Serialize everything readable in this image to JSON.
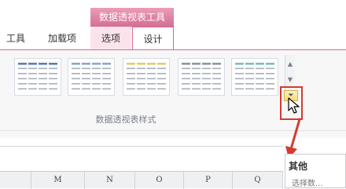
{
  "ribbon": {
    "context_tab_group": "数据透视表工具",
    "tabs": [
      {
        "label": "工具"
      },
      {
        "label": "加载项"
      },
      {
        "label": "选项"
      },
      {
        "label": "设计"
      }
    ],
    "active_tab": "设计",
    "gallery": {
      "group_label": "数据透视表样式",
      "styles": [
        {
          "name": "style-1",
          "accent": "#5b7db5"
        },
        {
          "name": "style-2",
          "accent": "#8aa6d1"
        },
        {
          "name": "style-3",
          "accent": "#e3cd6b"
        },
        {
          "name": "style-4",
          "accent": "#8e96a3"
        },
        {
          "name": "style-5",
          "accent": "#7ac0bc"
        }
      ],
      "more_button_icon": "gallery-more-icon",
      "scroll_up_icon": "scroll-up-icon",
      "scroll_down_icon": "scroll-down-icon"
    }
  },
  "sheet": {
    "columns": [
      "L",
      "M",
      "N",
      "O",
      "P",
      "Q"
    ]
  },
  "tooltip": {
    "title": "其他",
    "description": "选择数..."
  },
  "colors": {
    "context_header": "#d46e95",
    "annotation": "#d33b31",
    "more_button": "#f8da77"
  }
}
